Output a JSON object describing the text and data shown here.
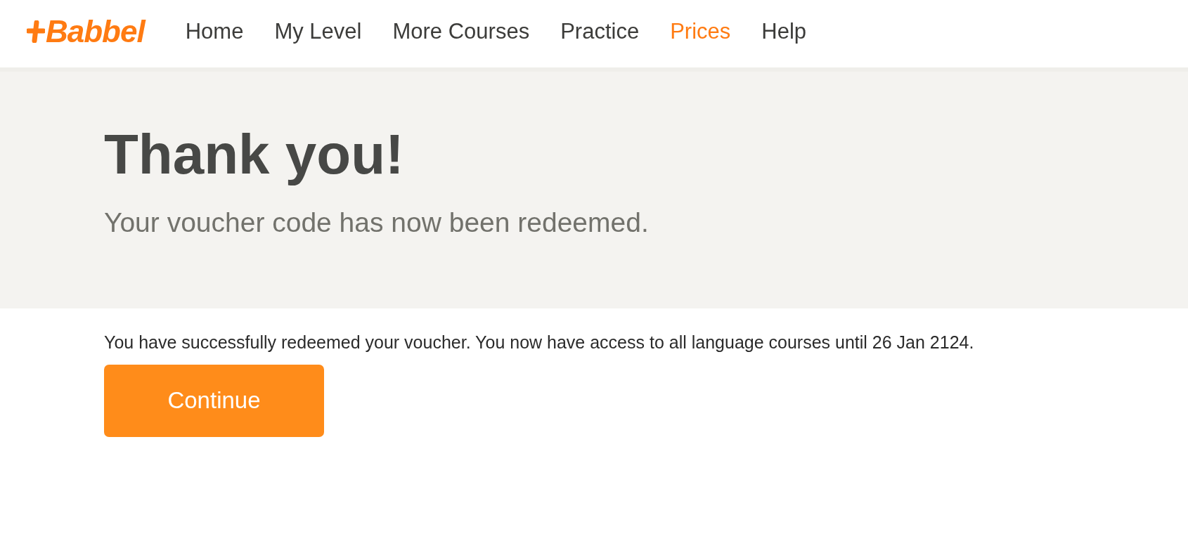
{
  "logo": {
    "text": "Babbel"
  },
  "nav": [
    {
      "label": "Home",
      "selected": false
    },
    {
      "label": "My Level",
      "selected": false
    },
    {
      "label": "More Courses",
      "selected": false
    },
    {
      "label": "Practice",
      "selected": false
    },
    {
      "label": "Prices",
      "selected": true
    },
    {
      "label": "Help",
      "selected": false
    }
  ],
  "hero": {
    "title": "Thank you!",
    "subtitle": "Your voucher code has now been redeemed."
  },
  "message": "You have successfully redeemed your voucher. You now have access to all language courses until 26 Jan 2124.",
  "button": "Continue"
}
